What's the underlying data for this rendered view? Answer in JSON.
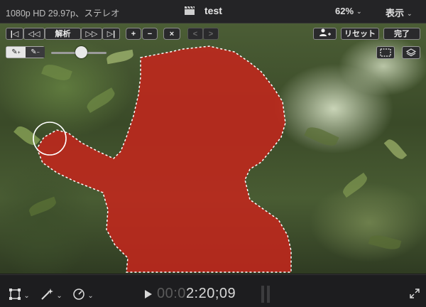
{
  "topbar": {
    "format": "1080p HD 29.97p、ステレオ",
    "project_title": "test",
    "zoom": "62%",
    "view_menu": "表示",
    "clapper_icon": "clapperboard-icon",
    "chevron_icon": "chevron-down-icon"
  },
  "controls": {
    "first_frame": "|◁",
    "step_back": "◁◁",
    "analyze_label": "解析",
    "step_forward": "▷▷",
    "last_frame": "▷|",
    "add_label": "+",
    "subtract_label": "−",
    "clear_label": "×",
    "prev_label": "<",
    "next_label": ">",
    "add_person_icon": "add-person-icon",
    "reset_label": "リセット",
    "done_label": "完了"
  },
  "tools": {
    "brush_add_icon": "paint-brush-add-icon",
    "brush_erase_icon": "paint-brush-erase-icon",
    "brush_size": 0.45,
    "selection_view_icon": "dashed-rectangle-icon",
    "matte_view_icon": "layers-icon"
  },
  "bottombar": {
    "transform_icon": "transform-crop-icon",
    "magic_wand_icon": "magic-wand-icon",
    "speed_icon": "speedometer-icon",
    "play_icon": "play-icon",
    "timecode_dim": "00:0",
    "timecode_bright": "2:20;09",
    "fullscreen_icon": "fullscreen-icon"
  },
  "colors": {
    "mask": "#c1271c",
    "background": "#1b1b1d",
    "accent": "#6a5acd"
  }
}
